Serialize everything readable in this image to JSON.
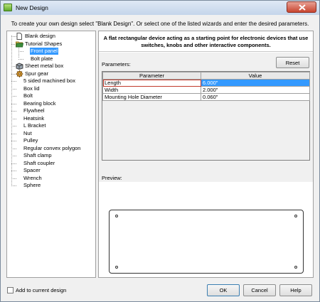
{
  "window": {
    "title": "New Design"
  },
  "instruction": "To create your own design select \"Blank Design\". Or select one of the listed wizards and enter the desired parameters.",
  "tree": {
    "items": [
      {
        "label": "Blank design",
        "icon": "blank-page-icon",
        "depth": 0
      },
      {
        "label": "Tutorial Shapes",
        "icon": "folder-open-icon",
        "depth": 0
      },
      {
        "label": "Front panel",
        "icon": "none",
        "depth": 1,
        "selected": true
      },
      {
        "label": "Bolt plate",
        "icon": "none",
        "depth": 1
      },
      {
        "label": "Sheet metal box",
        "icon": "sheet-metal-icon",
        "depth": 0
      },
      {
        "label": "Spur gear",
        "icon": "gear-icon",
        "depth": 0
      },
      {
        "label": "5 sided machined box",
        "icon": "none",
        "depth": 0
      },
      {
        "label": "Box lid",
        "icon": "none",
        "depth": 0
      },
      {
        "label": "Bolt",
        "icon": "none",
        "depth": 0
      },
      {
        "label": "Bearing block",
        "icon": "none",
        "depth": 0
      },
      {
        "label": "Flywheel",
        "icon": "none",
        "depth": 0
      },
      {
        "label": "Heatsink",
        "icon": "none",
        "depth": 0
      },
      {
        "label": "L Bracket",
        "icon": "none",
        "depth": 0
      },
      {
        "label": "Nut",
        "icon": "none",
        "depth": 0
      },
      {
        "label": "Pulley",
        "icon": "none",
        "depth": 0
      },
      {
        "label": "Regular convex polygon",
        "icon": "none",
        "depth": 0
      },
      {
        "label": "Shaft clamp",
        "icon": "none",
        "depth": 0
      },
      {
        "label": "Shaft coupler",
        "icon": "none",
        "depth": 0
      },
      {
        "label": "Spacer",
        "icon": "none",
        "depth": 0
      },
      {
        "label": "Wrench",
        "icon": "none",
        "depth": 0
      },
      {
        "label": "Sphere",
        "icon": "none",
        "depth": 0
      }
    ]
  },
  "description": "A flat rectangular device acting as a starting point for electronic devices that use switches, knobs and other interactive components.",
  "parameters": {
    "label": "Parameters:",
    "reset_label": "Reset",
    "columns": [
      "Parameter",
      "Value"
    ],
    "rows": [
      {
        "name": "Length",
        "value": "6.000\"",
        "selected": true
      },
      {
        "name": "Width",
        "value": "2.000\""
      },
      {
        "name": "Mounting Hole Diameter",
        "value": "0.060\""
      }
    ]
  },
  "preview": {
    "label": "Preview:"
  },
  "footer": {
    "checkbox_label": "Add to current design",
    "checkbox_checked": false,
    "ok_label": "OK",
    "cancel_label": "Cancel",
    "help_label": "Help"
  },
  "colors": {
    "selection": "#3399ff",
    "titlebar": "#c4d5ea",
    "close": "#c8452f"
  }
}
